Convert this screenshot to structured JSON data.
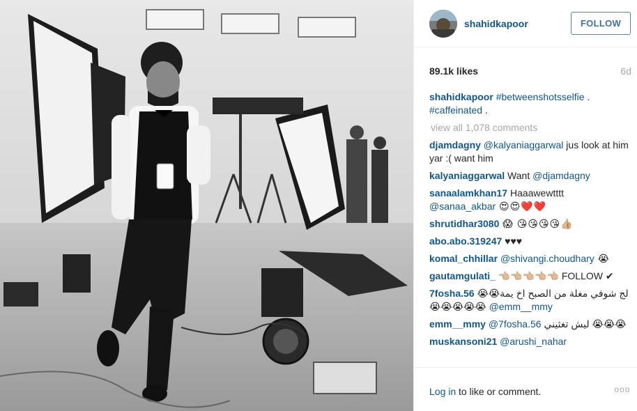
{
  "post": {
    "username": "shahidkapoor",
    "follow_label": "FOLLOW",
    "likes": "89.1k likes",
    "age": "6d"
  },
  "caption": {
    "user": "shahidkapoor",
    "tag1": "#betweenshotsselfie",
    "mid": " . ",
    "tag2": "#caffeinated",
    "end": " ."
  },
  "view_all": "view all 1,078 comments",
  "comments": [
    {
      "user": "djamdagny",
      "tag": "@kalyaniaggarwal",
      "text": " jus look at him yar :( want him"
    },
    {
      "user": "kalyaniaggarwal",
      "pre": " Want ",
      "tag": "@djamdagny",
      "text": ""
    },
    {
      "user": "sanaalamkhan17",
      "pre": " Haaawewtttt ",
      "tag": "@sanaa_akbar",
      "text": " 😍😍❤️❤️"
    },
    {
      "user": "shrutidhar3080",
      "text": " 😱 😘😘😘😘👍🏼"
    },
    {
      "user": "abo.abo.319247",
      "text": " ♥♥♥"
    },
    {
      "user": "komal_chhillar",
      "tag": "@shivangi.choudhary",
      "text": " 😭"
    },
    {
      "user": "gautamgulati_",
      "text": " 👈🏼👈🏼👈🏼👈🏼👈🏼 FOLLOW ✔"
    },
    {
      "user": "7fosha.56",
      "arabic": "لج شوفي مغلة من الصبح اخ يمة😭😭😭😭😭😭😭",
      "tag": "@emm__mmy",
      "text": ""
    },
    {
      "user": "emm__mmy",
      "tag": "@7fosha.56",
      "arabic": "ليش تغثيني",
      "text": " 😭😭😭"
    },
    {
      "user": "muskansoni21",
      "tag": "@arushi_nahar",
      "text": ""
    }
  ],
  "footer": {
    "login": "Log in",
    "rest": " to like or comment.",
    "more": "ooo"
  },
  "icons": {
    "more": "ellipsis-icon"
  },
  "colors": {
    "link": "#125688",
    "follow_border": "#4e86b8",
    "muted": "#a5a7aa"
  }
}
